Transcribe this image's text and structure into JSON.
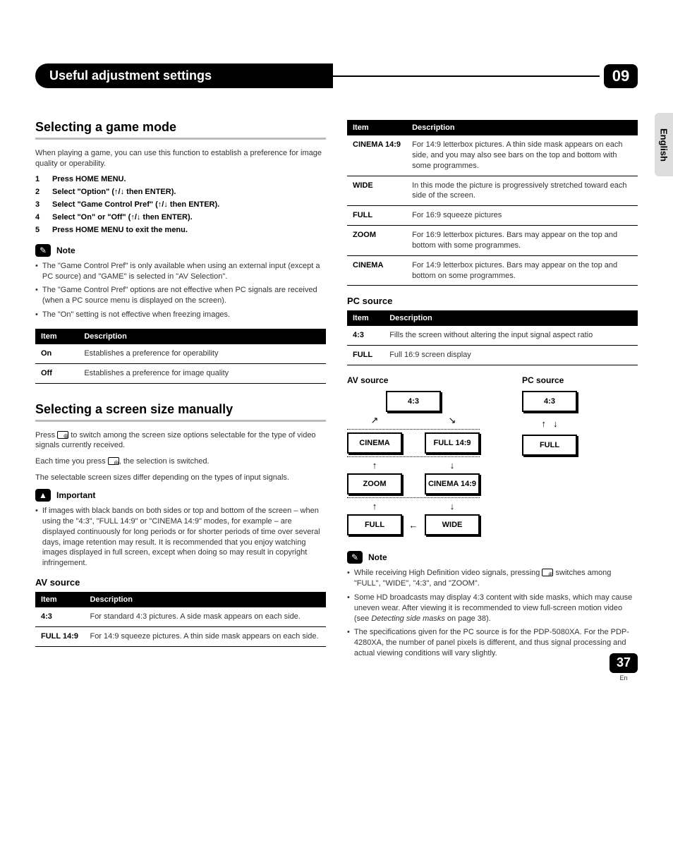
{
  "chapter": {
    "title": "Useful adjustment settings",
    "number": "09"
  },
  "lang_tab": "English",
  "page": {
    "num": "37",
    "lang": "En"
  },
  "left": {
    "section1_title": "Selecting a game mode",
    "intro1": "When playing a game, you can use this function to establish a preference for image quality or operability.",
    "steps": [
      {
        "n": "1",
        "t": "Press HOME MENU."
      },
      {
        "n": "2",
        "t": "Select \"Option\" (↑/↓ then ENTER)."
      },
      {
        "n": "3",
        "t": "Select \"Game Control Pref\" (↑/↓ then ENTER)."
      },
      {
        "n": "4",
        "t": "Select \"On\" or \"Off\" (↑/↓ then ENTER)."
      },
      {
        "n": "5",
        "t": "Press HOME MENU to exit the menu."
      }
    ],
    "note_label": "Note",
    "notes": [
      "The \"Game Control Pref\" is only available when using an external input (except a PC source) and \"GAME\" is selected in \"AV Selection\".",
      "The \"Game Control Pref\" options are not effective when PC signals are received (when a PC source menu is displayed on the screen).",
      "The \"On\" setting is not effective when freezing images."
    ],
    "table1": {
      "h1": "Item",
      "h2": "Description",
      "rows": [
        {
          "k": "On",
          "v": "Establishes a preference for operability"
        },
        {
          "k": "Off",
          "v": "Establishes a preference for image quality"
        }
      ]
    },
    "section2_title": "Selecting a screen size manually",
    "p2a_pre": "Press ",
    "p2a_post": " to switch among the screen size options selectable for the type of video signals currently received.",
    "p2b_pre": "Each time you press ",
    "p2b_post": ", the selection is switched.",
    "p2c": "The selectable screen sizes differ depending on the types of input signals.",
    "important_label": "Important",
    "important_text": "If images with black bands on both sides or top and bottom of the screen – when using the \"4:3\", \"FULL 14:9\" or \"CINEMA 14:9\" modes, for example – are displayed continuously for long periods or for shorter periods of time over several days, image retention may result. It is recommended that you enjoy watching images displayed in full screen, except when doing so may result in copyright infringement.",
    "av_source_h": "AV source",
    "table2": {
      "h1": "Item",
      "h2": "Description",
      "rows": [
        {
          "k": "4:3",
          "v": "For standard 4:3 pictures. A side mask appears on each side."
        },
        {
          "k": "FULL 14:9",
          "v": "For 14:9 squeeze pictures. A thin side mask appears on each side."
        }
      ]
    }
  },
  "right": {
    "table1": {
      "h1": "Item",
      "h2": "Description",
      "rows": [
        {
          "k": "CINEMA 14:9",
          "v": "For 14:9 letterbox pictures. A thin side mask appears on each side, and you may also see bars on the top and bottom with some programmes."
        },
        {
          "k": "WIDE",
          "v": "In this mode the picture is progressively stretched toward each side of the screen."
        },
        {
          "k": "FULL",
          "v": "For 16:9 squeeze pictures"
        },
        {
          "k": "ZOOM",
          "v": "For 16:9 letterbox pictures. Bars may appear on the top and bottom with some programmes."
        },
        {
          "k": "CINEMA",
          "v": "For 14:9 letterbox pictures. Bars may appear on the top and bottom on some programmes."
        }
      ]
    },
    "pc_source_h": "PC source",
    "table2": {
      "h1": "Item",
      "h2": "Description",
      "rows": [
        {
          "k": "4:3",
          "v": "Fills the screen without altering the input signal aspect ratio"
        },
        {
          "k": "FULL",
          "v": "Full 16:9 screen display"
        }
      ]
    },
    "diag": {
      "av_h": "AV source",
      "pc_h": "PC source",
      "b_43": "4:3",
      "b_cinema": "CINEMA",
      "b_full149": "FULL 14:9",
      "b_zoom": "ZOOM",
      "b_cinema149": "CINEMA 14:9",
      "b_full": "FULL",
      "b_wide": "WIDE"
    },
    "note_label": "Note",
    "notes_pre0": "While receiving High Definition video signals, pressing ",
    "notes_post0": " switches among \"FULL\", \"WIDE\", \"4:3\", and \"ZOOM\".",
    "notes_1a": "Some HD broadcasts may display 4:3 content with side masks, which may cause uneven wear. After viewing it is recommended to view full-screen motion video (see ",
    "notes_1em": "Detecting side masks",
    "notes_1b": " on page 38).",
    "notes_2": "The specifications given for the PC source is for the PDP-5080XA. For the PDP-4280XA, the number of panel pixels is different, and thus signal processing and actual viewing conditions will vary slightly."
  }
}
